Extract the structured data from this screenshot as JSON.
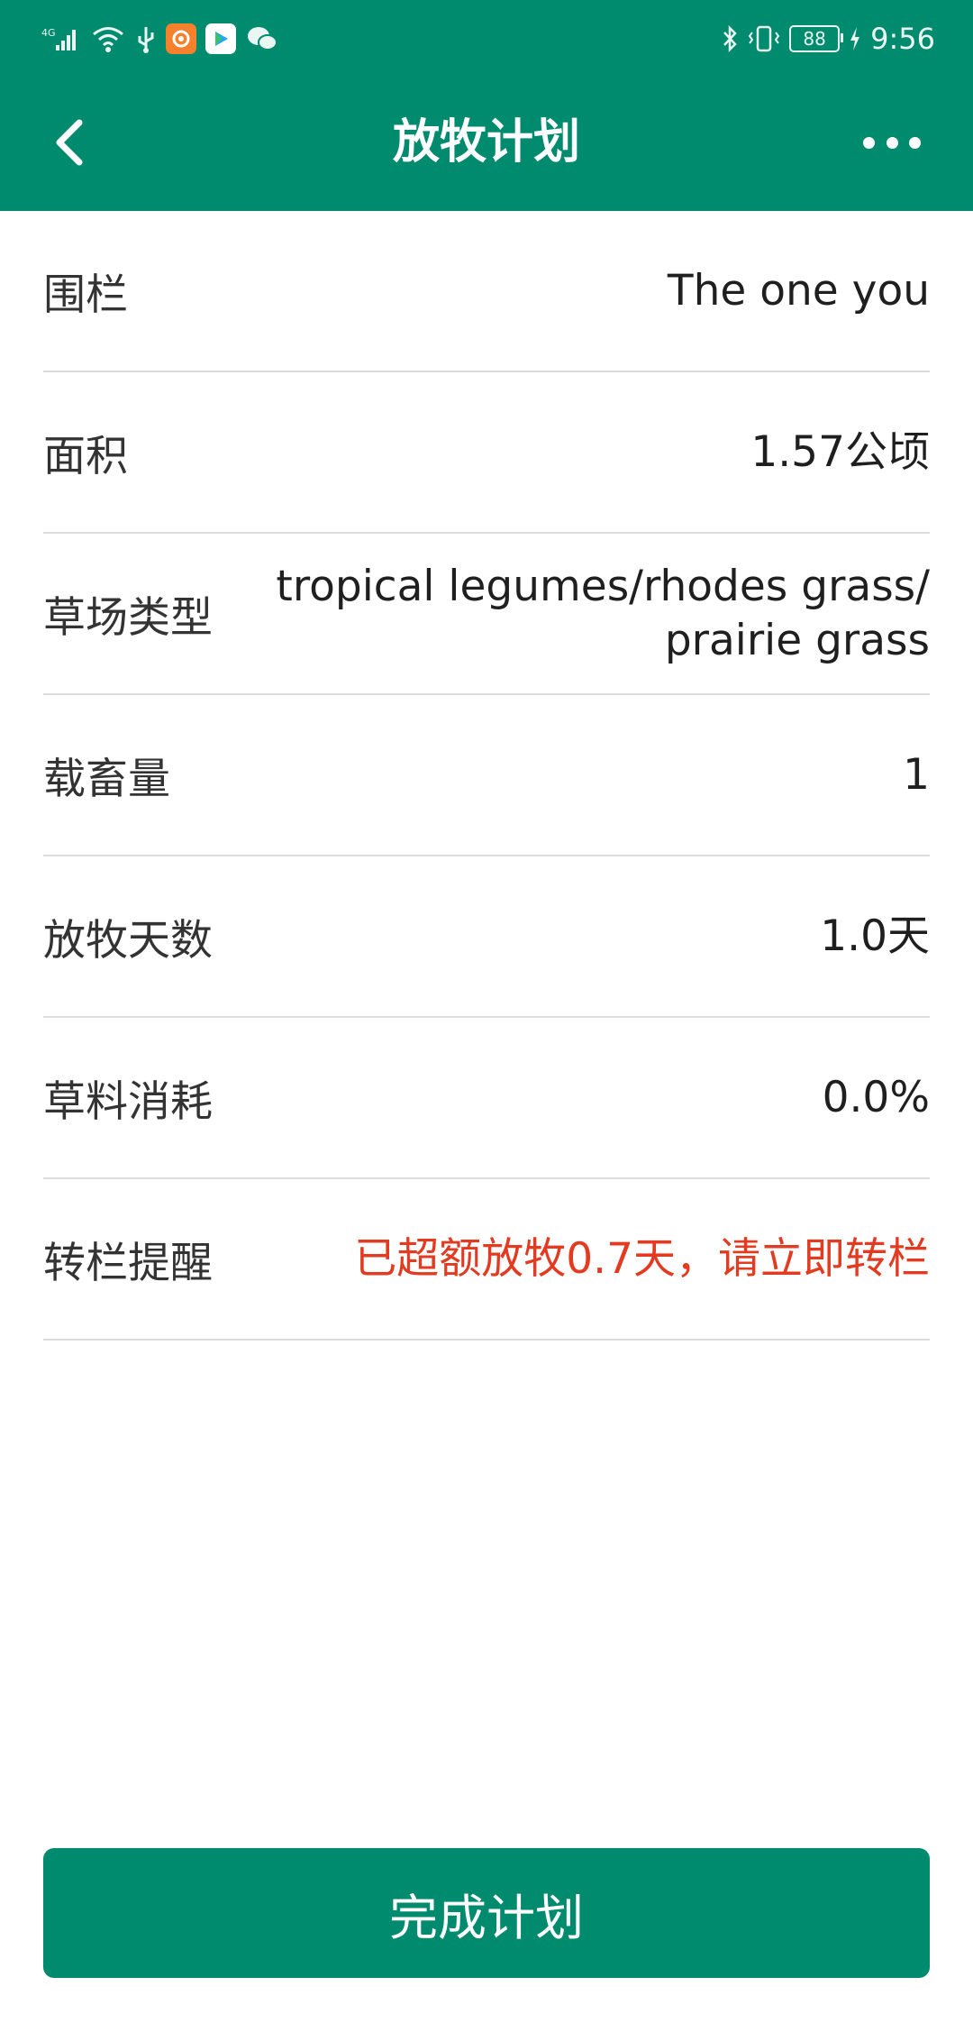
{
  "status": {
    "network": "4G",
    "battery": "88",
    "time": "9:56"
  },
  "app_bar": {
    "title": "放牧计划"
  },
  "rows": [
    {
      "label": "围栏",
      "value": "The one you"
    },
    {
      "label": "面积",
      "value": "1.57公顷"
    },
    {
      "label": "草场类型",
      "value": "tropical legumes/rhodes grass/\nprairie grass"
    },
    {
      "label": "载畜量",
      "value": "1"
    },
    {
      "label": "放牧天数",
      "value": "1.0天"
    },
    {
      "label": "草料消耗",
      "value": "0.0%"
    },
    {
      "label": "转栏提醒",
      "value": "已超额放牧0.7天，请立即转栏"
    }
  ],
  "footer": {
    "button_label": "完成计划"
  },
  "colors": {
    "primary": "#008a6e",
    "warning": "#e23b22"
  },
  "icons": {
    "back": "chevron-left-icon",
    "more": "more-dots-icon",
    "signal": "signal-icon",
    "wifi": "wifi-icon",
    "usb": "usb-icon",
    "bluetooth": "bluetooth-icon",
    "vibrate": "vibrate-icon",
    "charging": "charging-icon"
  }
}
